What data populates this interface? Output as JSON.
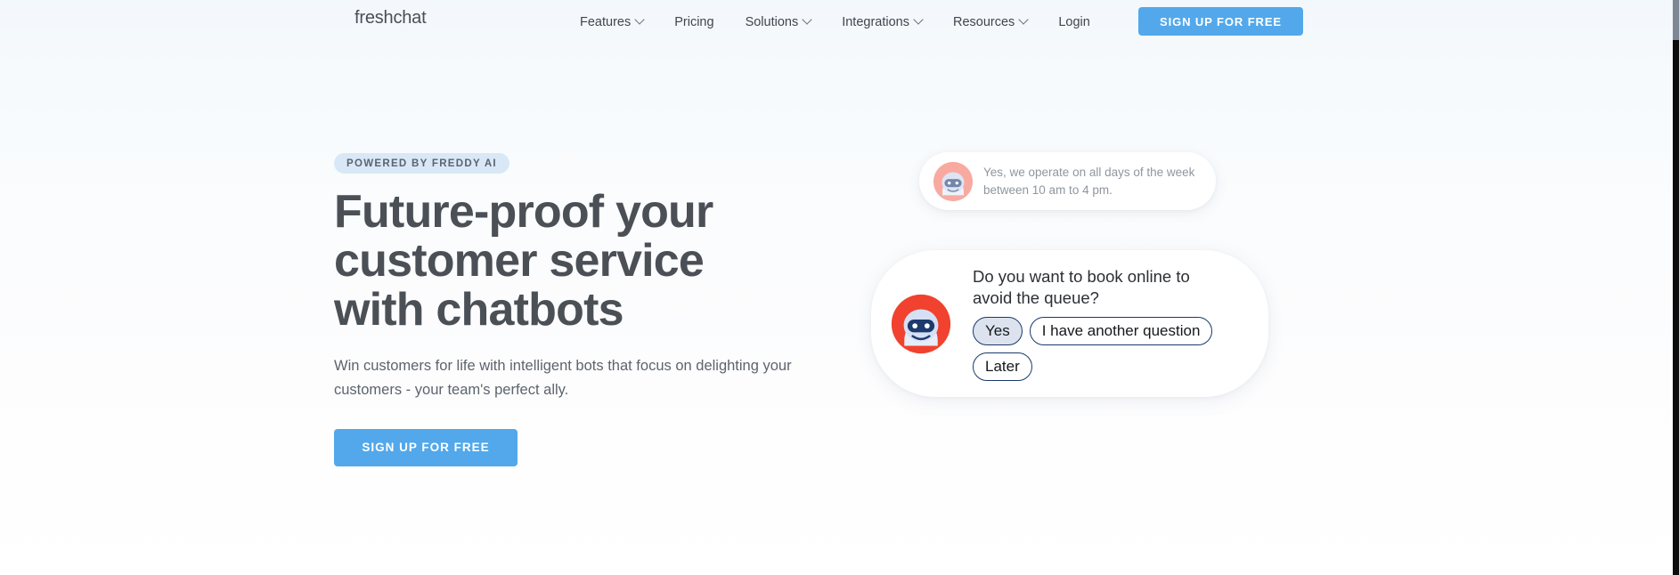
{
  "header": {
    "logo": "freshchat",
    "nav": [
      {
        "label": "Features",
        "has_dropdown": true
      },
      {
        "label": "Pricing",
        "has_dropdown": false
      },
      {
        "label": "Solutions",
        "has_dropdown": true
      },
      {
        "label": "Integrations",
        "has_dropdown": true
      },
      {
        "label": "Resources",
        "has_dropdown": true
      },
      {
        "label": "Login",
        "has_dropdown": false
      }
    ],
    "cta_label": "SIGN UP FOR FREE"
  },
  "hero": {
    "badge": "POWERED BY FREDDY AI",
    "title": "Future-proof your customer service with chatbots",
    "subtitle": "Win customers for life with intelligent bots that focus on delighting your customers - your team's perfect ally.",
    "cta_label": "SIGN UP FOR FREE"
  },
  "chat": {
    "small_bubble": {
      "avatar": "bot-avatar-faded",
      "message": "Yes, we operate on all days of the week between 10 am to 4 pm."
    },
    "large_bubble": {
      "avatar": "bot-avatar",
      "question": "Do you want to book online to avoid the queue?",
      "replies": [
        {
          "label": "Yes",
          "state": "active"
        },
        {
          "label": "I have another question",
          "state": "default"
        },
        {
          "label": "Later",
          "state": "default"
        }
      ]
    }
  },
  "colors": {
    "accent_blue": "#52a8ea",
    "badge_bg": "#d9e8f6",
    "bot_red": "#f0422e",
    "bot_navy": "#1d3a6e",
    "bot_helmet": "#d6e0f5",
    "reply_border": "#1a3a6b",
    "reply_active_bg": "#dde3ee",
    "heading": "#4b5056",
    "body_text": "#5d646c",
    "page_bg_top": "#f3f8fc",
    "page_bg_bottom": "#ffffff"
  },
  "scrollbar": {
    "thumb_position": "top",
    "track_color": "#0d0d0d",
    "thumb_color": "#7d8894"
  }
}
